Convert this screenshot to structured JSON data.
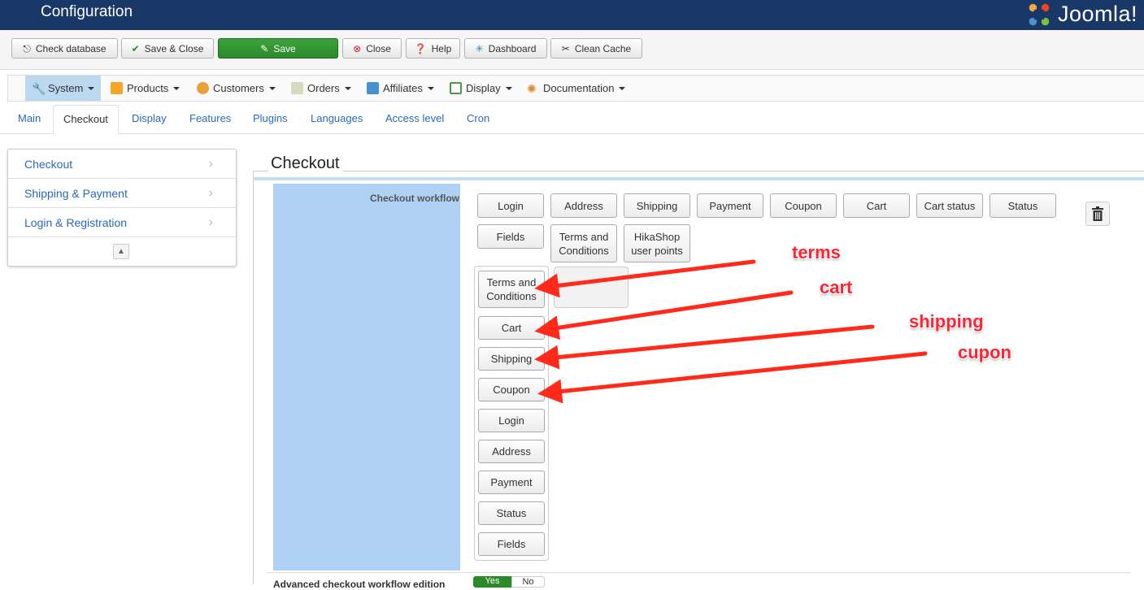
{
  "header": {
    "title": "Configuration",
    "logo_text": "Joomla!"
  },
  "toolbar": {
    "check_database": "Check database",
    "save_close": "Save & Close",
    "save": "Save",
    "close": "Close",
    "help": "Help",
    "dashboard": "Dashboard",
    "clean_cache": "Clean Cache"
  },
  "menu": {
    "system": "System",
    "products": "Products",
    "customers": "Customers",
    "orders": "Orders",
    "affiliates": "Affiliates",
    "display": "Display",
    "documentation": "Documentation"
  },
  "tabs": [
    "Main",
    "Checkout",
    "Display",
    "Features",
    "Plugins",
    "Languages",
    "Access level",
    "Cron"
  ],
  "sidenav": [
    "Checkout",
    "Shipping & Payment",
    "Login & Registration"
  ],
  "section": {
    "legend": "Checkout",
    "workflow_label": "Checkout workflow",
    "bottom_label": "Advanced checkout workflow edition",
    "yes": "Yes",
    "no": "No"
  },
  "available_steps_row1": [
    "Login",
    "Address",
    "Shipping",
    "Payment",
    "Coupon",
    "Cart",
    "Cart status",
    "Status"
  ],
  "available_steps_row2": [
    "Fields",
    "Terms and Conditions",
    "HikaShop user points"
  ],
  "step_column": [
    "Terms and Conditions",
    "Cart",
    "Shipping",
    "Coupon",
    "Login",
    "Address",
    "Payment",
    "Status",
    "Fields"
  ],
  "annotations": [
    "terms",
    "cart",
    "shipping",
    "cupon"
  ],
  "colors": {
    "header_bg": "#1a3867",
    "annotation": "#ff2a1a",
    "label_column": "#aed1f4",
    "save_green": "#2e8f2e"
  }
}
